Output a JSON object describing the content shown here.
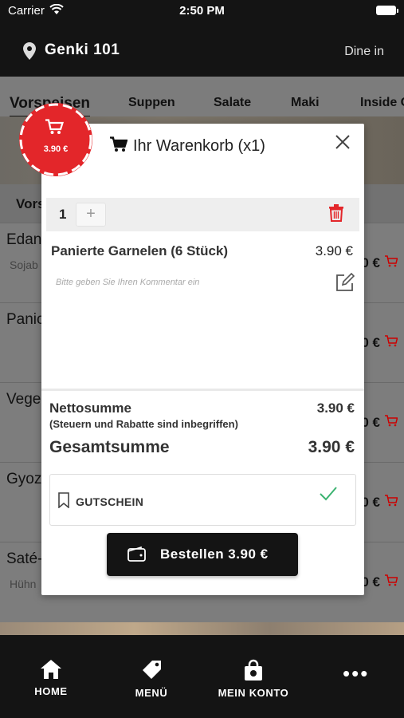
{
  "status": {
    "carrier": "Carrier",
    "time": "2:50 PM"
  },
  "header": {
    "store_name": "Genki 101",
    "mode": "Dine in"
  },
  "categories": [
    "Vorspeisen",
    "Suppen",
    "Salate",
    "Maki",
    "Inside Out"
  ],
  "background": {
    "section_title": "Vors",
    "rows": [
      {
        "name": "Edan",
        "sub": "Sojab",
        "price": "0 €"
      },
      {
        "name": "Panic",
        "sub": "",
        "price": "0 €"
      },
      {
        "name": "Vege",
        "sub": "",
        "price": "0 €"
      },
      {
        "name": "Gyoz",
        "sub": "",
        "price": "0 €"
      },
      {
        "name": "Saté-",
        "sub": "Hühn",
        "price": "0 €"
      }
    ]
  },
  "cart_badge": {
    "price": "3.90 €"
  },
  "modal": {
    "title": "Ihr Warenkorb (x1)",
    "quantity": "1",
    "plus_label": "+",
    "item_name": "Panierte Garnelen (6 Stück)",
    "item_price": "3.90 €",
    "comment_placeholder": "Bitte geben Sie Ihren Kommentar ein",
    "net_label": "Nettosumme",
    "net_value": "3.90 €",
    "tax_note": "(Steuern und Rabatte sind inbegriffen)",
    "total_label": "Gesamtsumme",
    "total_value": "3.90 €",
    "voucher_label": "GUTSCHEIN",
    "order_label": "Bestellen 3.90 €"
  },
  "bottom_nav": {
    "home": "HOME",
    "menu": "MENÜ",
    "account": "MEIN KONTO",
    "more": "•••"
  },
  "colors": {
    "accent_red": "#e3262a",
    "dark": "#141414",
    "check_green": "#3cb371"
  },
  "icons": [
    "wifi-icon",
    "battery-icon",
    "location-pin-icon",
    "cart-icon",
    "close-icon",
    "trash-icon",
    "edit-icon",
    "bookmark-icon",
    "check-icon",
    "wallet-icon",
    "home-icon",
    "tag-icon",
    "bag-icon",
    "more-icon"
  ]
}
